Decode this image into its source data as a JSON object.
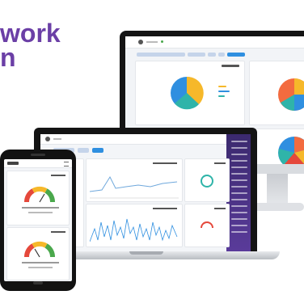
{
  "hero": {
    "line1": "work",
    "line2": "n",
    "color": "#6b3fa6"
  },
  "colors": {
    "yellow": "#f6b82a",
    "blue": "#2f8fe0",
    "teal": "#2fb4a9",
    "orange": "#f36b3f",
    "red": "#e5483b",
    "green": "#4aa84c",
    "purple": "#5a3b9a"
  },
  "icons": [
    "logo-icon",
    "avatar",
    "gauge-icon",
    "pie-chart-icon",
    "line-chart-icon"
  ]
}
